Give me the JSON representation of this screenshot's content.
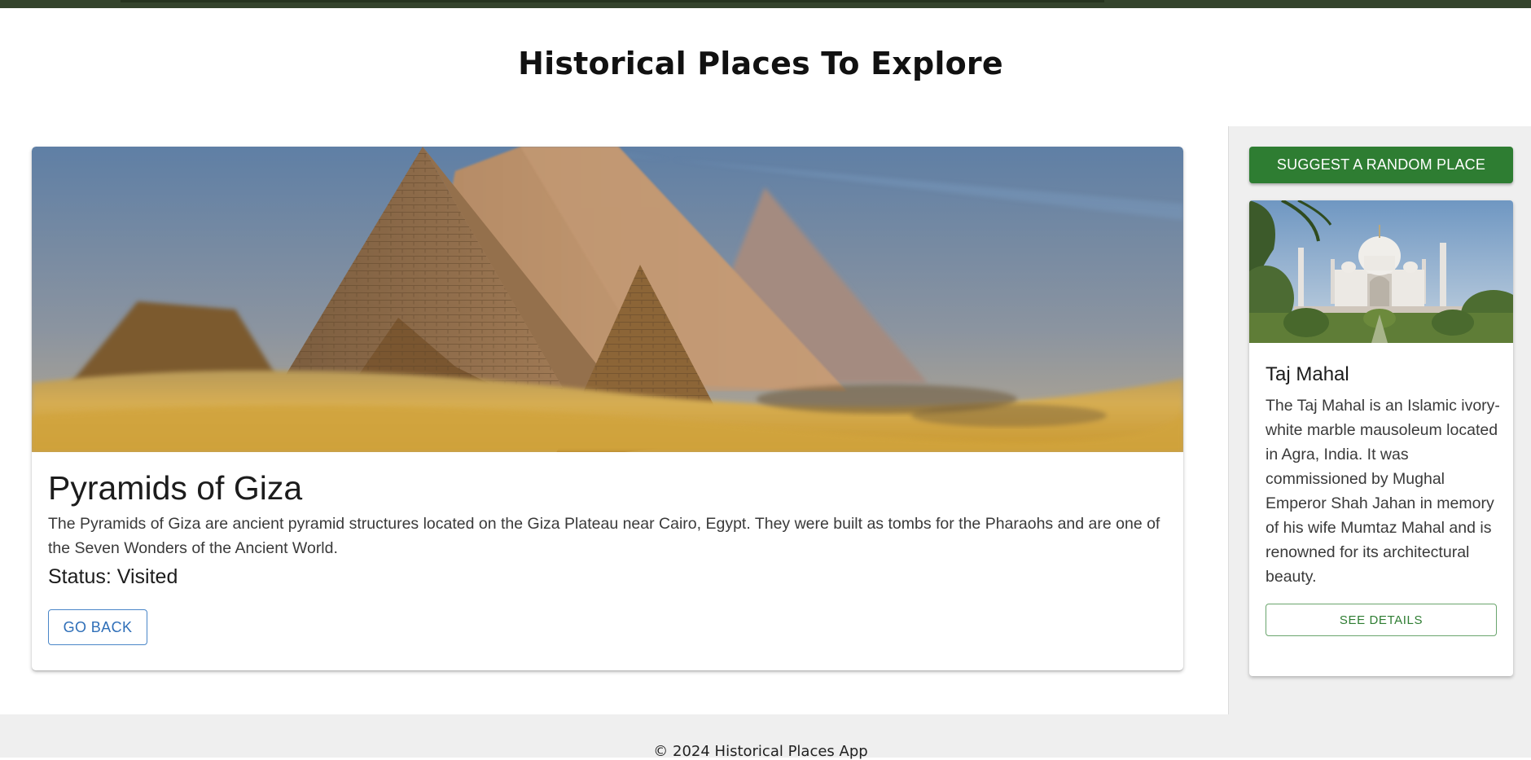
{
  "header": {
    "title": "Historical Places To Explore"
  },
  "main": {
    "image_subject": "pyramids-photo",
    "title": "Pyramids of Giza",
    "description": "The Pyramids of Giza are ancient pyramid structures located on the Giza Plateau near Cairo, Egypt. They were built as tombs for the Pharaohs and are one of the Seven Wonders of the Ancient World.",
    "status": "Status: Visited",
    "back_label": "GO BACK"
  },
  "sidebar": {
    "suggest_label": "SUGGEST A RANDOM PLACE",
    "card": {
      "image_subject": "taj-mahal-photo",
      "title": "Taj Mahal",
      "description": "The Taj Mahal is an Islamic ivory-white marble mausoleum located in Agra, India. It was commissioned by Mughal Emperor Shah Jahan in memory of his wife Mumtaz Mahal and is renowned for its architectural beauty.",
      "details_label": "SEE DETAILS"
    }
  },
  "footer": {
    "text": "© 2024 Historical Places App"
  },
  "colors": {
    "topbar": "#34432c",
    "primary_green": "#2e7d32",
    "link_blue": "#2f6fb8",
    "sidebar_bg": "#efefef"
  }
}
